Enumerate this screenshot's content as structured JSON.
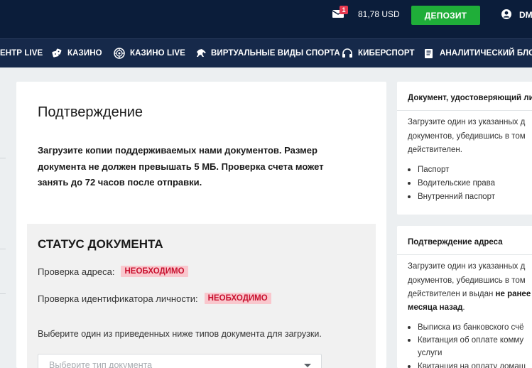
{
  "header": {
    "mail_count": "1",
    "balance": "81,78 USD",
    "deposit_label": "ДЕПОЗИТ",
    "user_label": "DM"
  },
  "nav": {
    "items": [
      {
        "label": "ЕНТР LIVE",
        "icon": "none"
      },
      {
        "label": "КАЗИНО",
        "icon": "dice-icon"
      },
      {
        "label": "КАЗИНО LIVE",
        "icon": "roulette-icon"
      },
      {
        "label": "ВИРТУАЛЬНЫЕ ВИДЫ СПОРТА",
        "icon": "horse-icon"
      },
      {
        "label": "КИБЕРСПОРТ",
        "icon": "headset-icon"
      },
      {
        "label": "АНАЛИТИЧЕСКИЙ БЛОГ",
        "icon": "blog-icon"
      }
    ]
  },
  "main": {
    "title": "Подтверждение",
    "description_lines": [
      "Загрузите копии поддерживаемых нами документов. Размер",
      "документа не должен превышать 5 МБ. Проверка счета может",
      "занять до 72 часов после отправки."
    ],
    "status": {
      "title": "СТАТУС ДОКУМЕНТА",
      "address_label": "Проверка адреса:",
      "address_status": "НЕОБХОДИМО",
      "identity_label": "Проверка идентификатора личности:",
      "identity_status": "НЕОБХОДИМО",
      "choose_text": "Выберите один из приведенных ниже типов документа для загрузки.",
      "select_placeholder": "Выберите тип документа"
    }
  },
  "side": {
    "identity": {
      "title": "Документ, удостоверяющий ли",
      "lines": [
        "Загрузите один из указанных д",
        "документов, убедившись в том",
        "действителен."
      ],
      "items": [
        "Паспорт",
        "Водительские права",
        "Внутренний паспорт"
      ]
    },
    "address": {
      "title": "Подтверждение адреса",
      "lines": [
        "Загрузите один из указанных д",
        "документов, убедившись в том"
      ],
      "line3_prefix": "действителен и выдан ",
      "line3_bold": "не ранее",
      "line4_bold": "месяца назад",
      "line4_suffix": ".",
      "items": [
        "Выписка из банковского счё",
        "Квитанция об оплате комму"
      ],
      "item2_cont": "услуги",
      "item3": "Квитанция на оплату домаш"
    }
  },
  "colors": {
    "header_bg": "#0b1d3a",
    "nav_bg": "#16294a",
    "deposit_green": "#1fae39",
    "badge_bg": "#f9c7cd",
    "badge_text": "#c8102e"
  }
}
